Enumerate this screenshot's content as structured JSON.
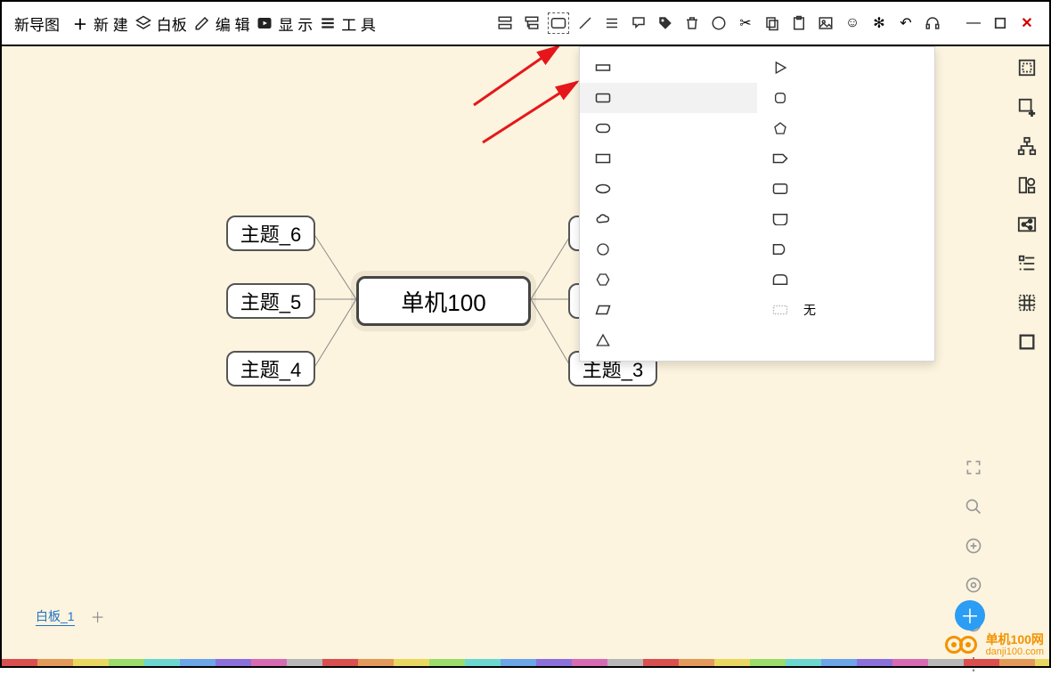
{
  "app_title": "新导图",
  "menu": {
    "new": "新 建",
    "board": "白板",
    "edit": "编 辑",
    "display": "显 示",
    "tools": "工 具"
  },
  "central_node": "单机100",
  "nodes": {
    "t6": "主题_6",
    "t5": "主题_5",
    "t4": "主题_4",
    "t3": "主题_3"
  },
  "shape_dropdown": {
    "col2_none": "无"
  },
  "bottom_tab": {
    "name": "白板_1"
  },
  "watermark": {
    "line1": "单机100网",
    "line2": "danji100.com"
  }
}
